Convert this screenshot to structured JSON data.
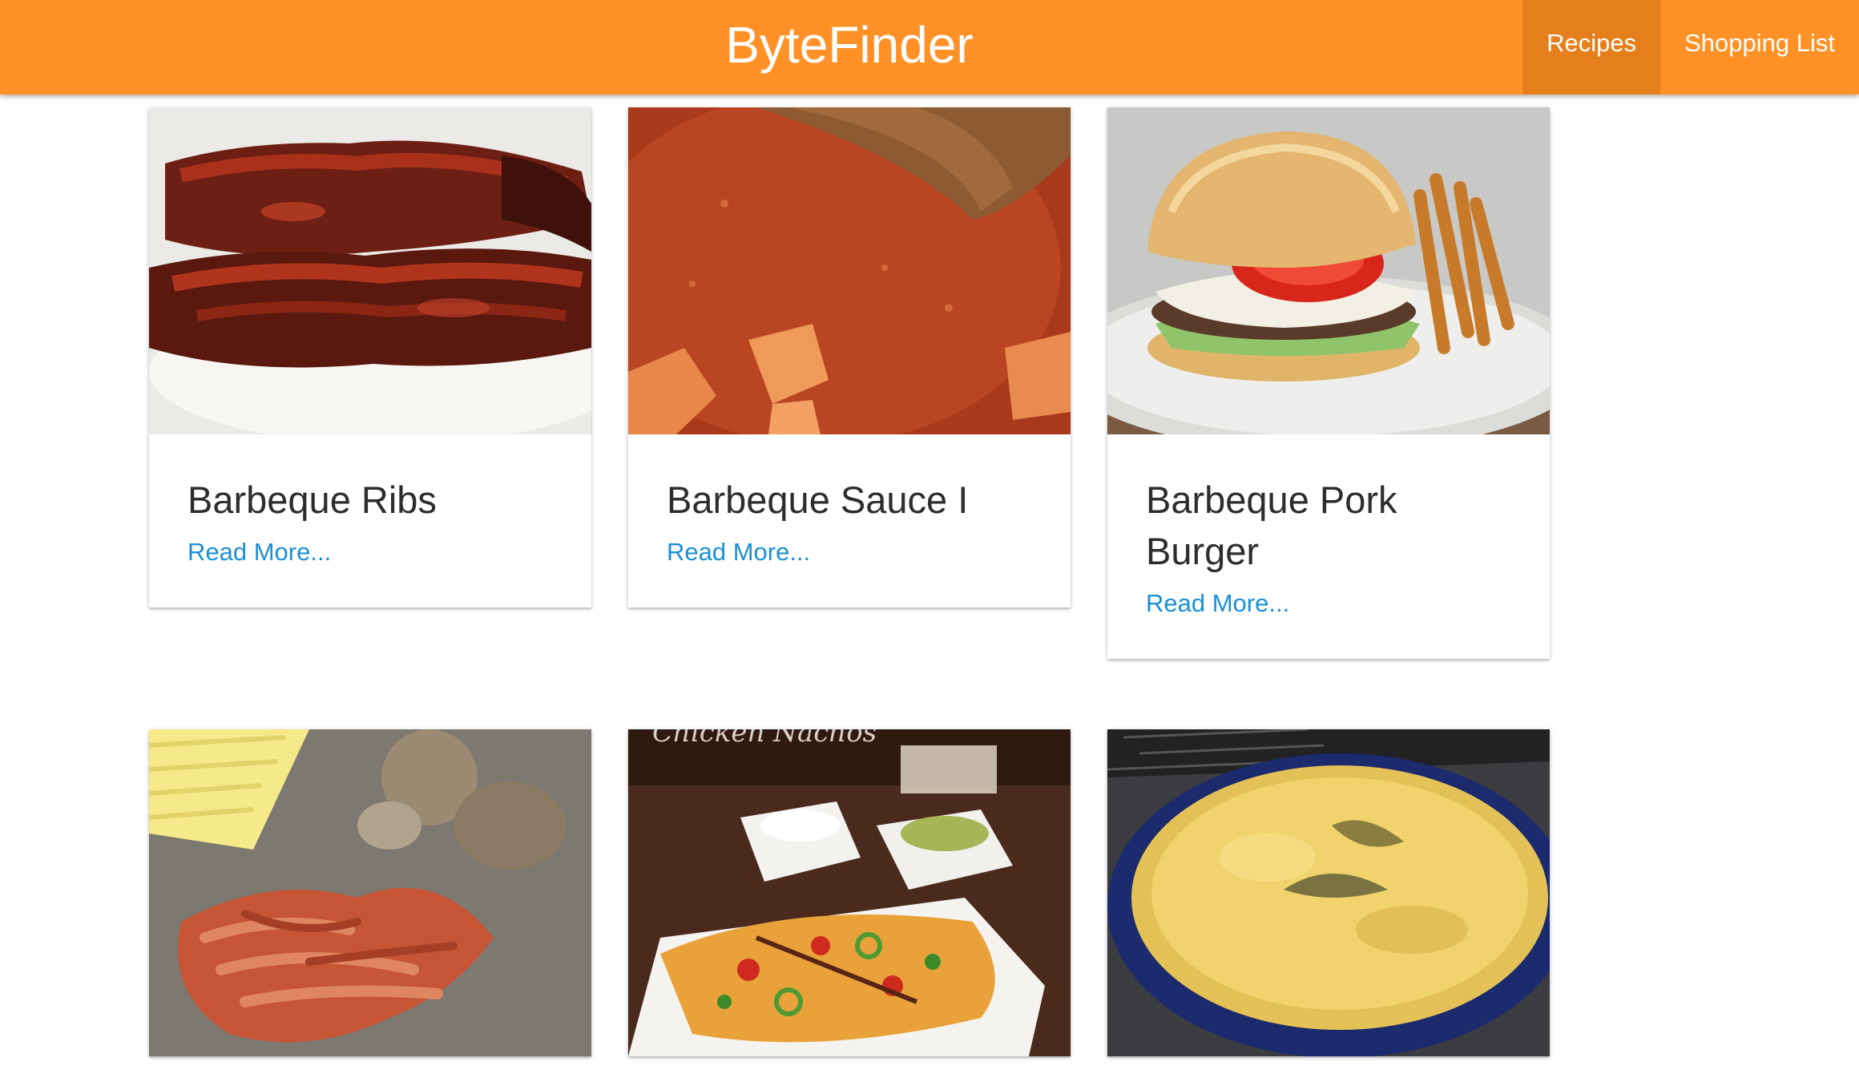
{
  "app": {
    "brand": "ByteFinder",
    "accent_color": "#ff9126",
    "active_nav_color": "#e57f1c",
    "link_color": "#1a8fd6"
  },
  "nav": {
    "recipes": "Recipes",
    "shopping_list": "Shopping List"
  },
  "recipes": [
    {
      "title": "Barbeque Ribs",
      "link": "Read More...",
      "image": "barbeque-ribs-photo"
    },
    {
      "title": "Barbeque Sauce I",
      "link": "Read More...",
      "image": "barbeque-sauce-photo"
    },
    {
      "title": "Barbeque Pork Burger",
      "link": "Read More...",
      "image": "pork-burger-photo"
    },
    {
      "image": "pulled-chicken-photo"
    },
    {
      "image": "chicken-nachos-photo",
      "image_text": "Chicken Nachos"
    },
    {
      "image": "cornbread-photo"
    }
  ]
}
